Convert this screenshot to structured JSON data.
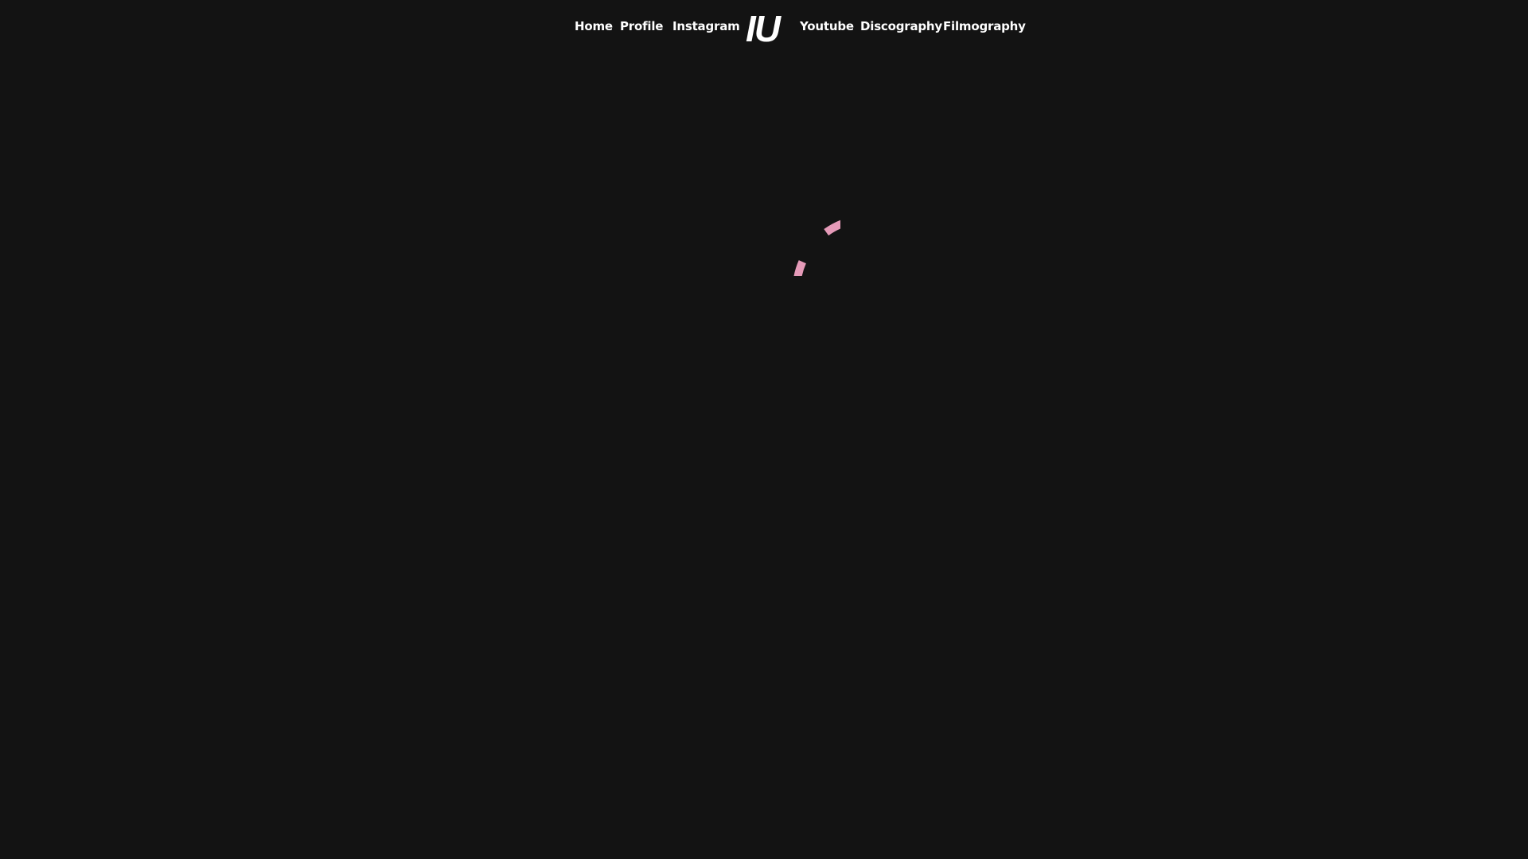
{
  "nav": {
    "left_items": [
      "Home",
      "Profile",
      "Instagram"
    ],
    "logo": "IU",
    "right_items": [
      "Youtube",
      "Discography",
      "Filmography"
    ]
  },
  "spinner": {
    "icon": "loading-spinner-icon",
    "color": "#e59ab8"
  },
  "colors": {
    "background": "#131313",
    "text": "#ffffff",
    "accent": "#e59ab8"
  }
}
